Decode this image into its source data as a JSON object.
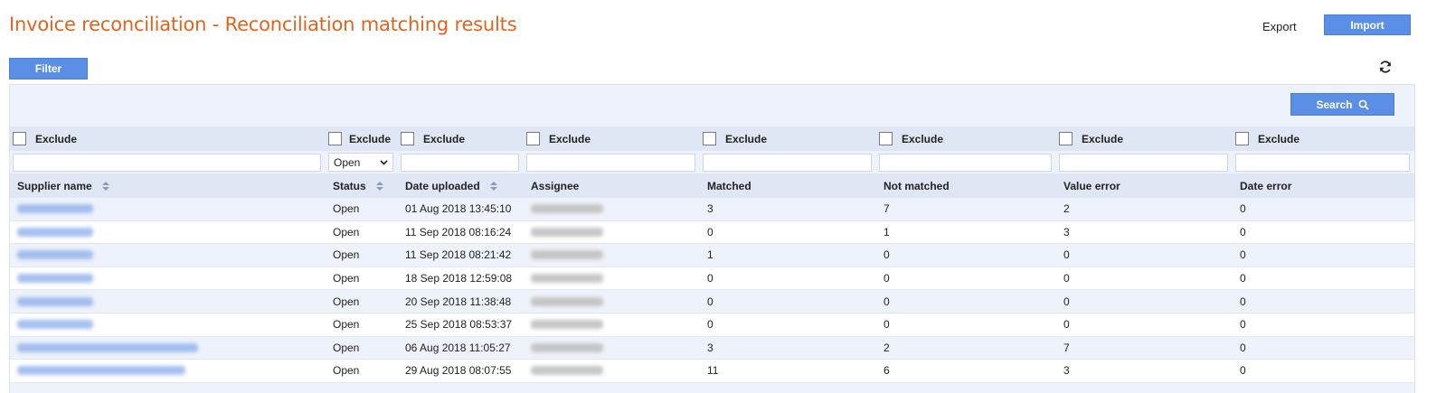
{
  "header": {
    "title": "Invoice reconciliation - Reconciliation matching results",
    "export_label": "Export",
    "import_label": "Import"
  },
  "toolbar": {
    "filter_label": "Filter",
    "refresh_icon": "refresh-icon",
    "search_label": "Search",
    "search_icon": "search-icon"
  },
  "colors": {
    "title": "#e0641e",
    "primary_button": "#5b8fe6",
    "header_bg": "#dfe7f5",
    "panel_bg": "#eef2fa"
  },
  "exclude_label": "Exclude",
  "status_filter": {
    "selected": "Open"
  },
  "columns": [
    "Supplier name",
    "Status",
    "Date uploaded",
    "Assignee",
    "Matched",
    "Not matched",
    "Value error",
    "Date error"
  ],
  "rows": [
    {
      "status": "Open",
      "date_uploaded": "01 Aug 2018 13:45:10",
      "matched": "3",
      "not_matched": "7",
      "value_error": "2",
      "date_error": "0"
    },
    {
      "status": "Open",
      "date_uploaded": "11 Sep 2018 08:16:24",
      "matched": "0",
      "not_matched": "1",
      "value_error": "3",
      "date_error": "0"
    },
    {
      "status": "Open",
      "date_uploaded": "11 Sep 2018 08:21:42",
      "matched": "1",
      "not_matched": "0",
      "value_error": "0",
      "date_error": "0"
    },
    {
      "status": "Open",
      "date_uploaded": "18 Sep 2018 12:59:08",
      "matched": "0",
      "not_matched": "0",
      "value_error": "0",
      "date_error": "0"
    },
    {
      "status": "Open",
      "date_uploaded": "20 Sep 2018 11:38:48",
      "matched": "0",
      "not_matched": "0",
      "value_error": "0",
      "date_error": "0"
    },
    {
      "status": "Open",
      "date_uploaded": "25 Sep 2018 08:53:37",
      "matched": "0",
      "not_matched": "0",
      "value_error": "0",
      "date_error": "0"
    },
    {
      "status": "Open",
      "date_uploaded": "06 Aug 2018 11:05:27",
      "matched": "3",
      "not_matched": "2",
      "value_error": "7",
      "date_error": "0"
    },
    {
      "status": "Open",
      "date_uploaded": "29 Aug 2018 08:07:55",
      "matched": "11",
      "not_matched": "6",
      "value_error": "3",
      "date_error": "0"
    }
  ]
}
